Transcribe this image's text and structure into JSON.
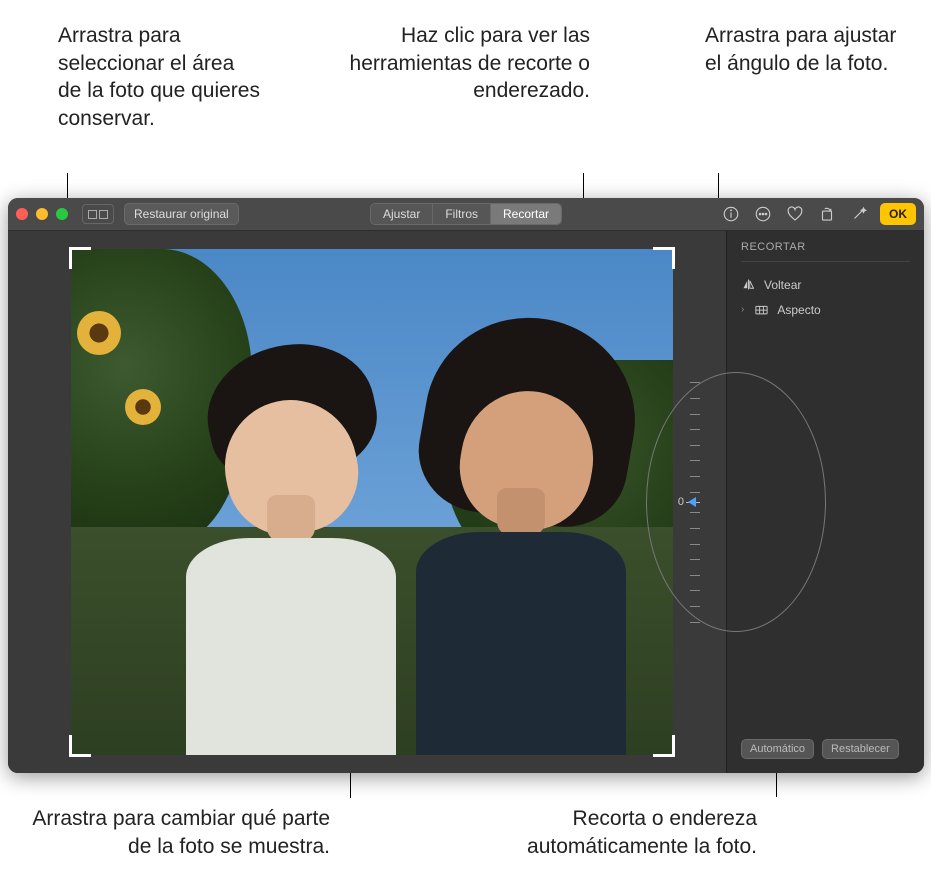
{
  "callouts": {
    "top_left": "Arrastra para seleccionar el área de la foto que quieres conservar.",
    "top_mid": "Haz clic para ver las herramientas de recorte o enderezado.",
    "top_right": "Arrastra para ajustar el ángulo de la foto.",
    "bottom_left": "Arrastra para cambiar qué parte de la foto se muestra.",
    "bottom_right": "Recorta o endereza automáticamente la foto."
  },
  "toolbar": {
    "restore_label": "Restaurar original",
    "tabs": {
      "adjust": "Ajustar",
      "filters": "Filtros",
      "crop": "Recortar"
    },
    "done_label": "OK"
  },
  "panel": {
    "title": "RECORTAR",
    "items": {
      "flip": "Voltear",
      "aspect": "Aspecto"
    },
    "buttons": {
      "auto": "Automático",
      "reset": "Restablecer"
    }
  },
  "angle": {
    "value": "0"
  }
}
